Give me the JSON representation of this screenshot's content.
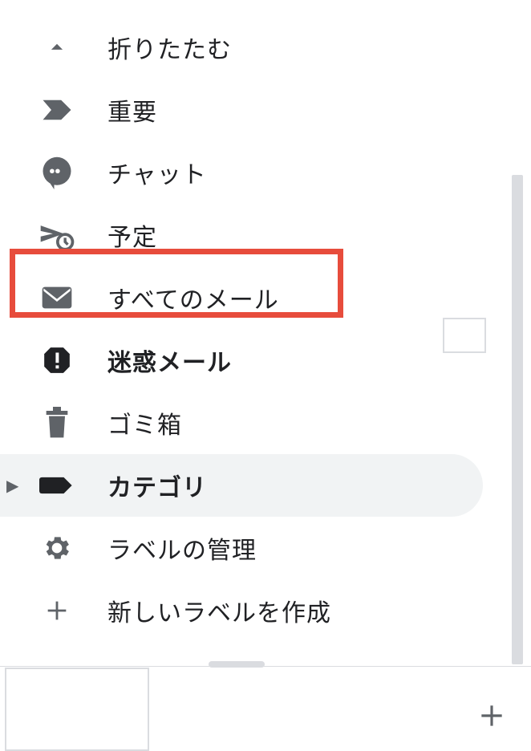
{
  "sidebar": {
    "items": [
      {
        "label": "折りたたむ",
        "icon": "chevron-up",
        "bold": false
      },
      {
        "label": "重要",
        "icon": "important",
        "bold": false
      },
      {
        "label": "チャット",
        "icon": "chat",
        "bold": false
      },
      {
        "label": "予定",
        "icon": "scheduled",
        "bold": false
      },
      {
        "label": "すべてのメール",
        "icon": "mail",
        "bold": false,
        "highlighted": true
      },
      {
        "label": "迷惑メール",
        "icon": "spam",
        "bold": true
      },
      {
        "label": "ゴミ箱",
        "icon": "trash",
        "bold": false
      },
      {
        "label": "カテゴリ",
        "icon": "label",
        "bold": true,
        "hovered": true,
        "expandable": true
      },
      {
        "label": "ラベルの管理",
        "icon": "gear",
        "bold": false
      },
      {
        "label": "新しいラベルを作成",
        "icon": "plus",
        "bold": false
      }
    ]
  },
  "colors": {
    "icon": "#5f6368",
    "boldIcon": "#202124",
    "highlight": "#e74c3c"
  }
}
